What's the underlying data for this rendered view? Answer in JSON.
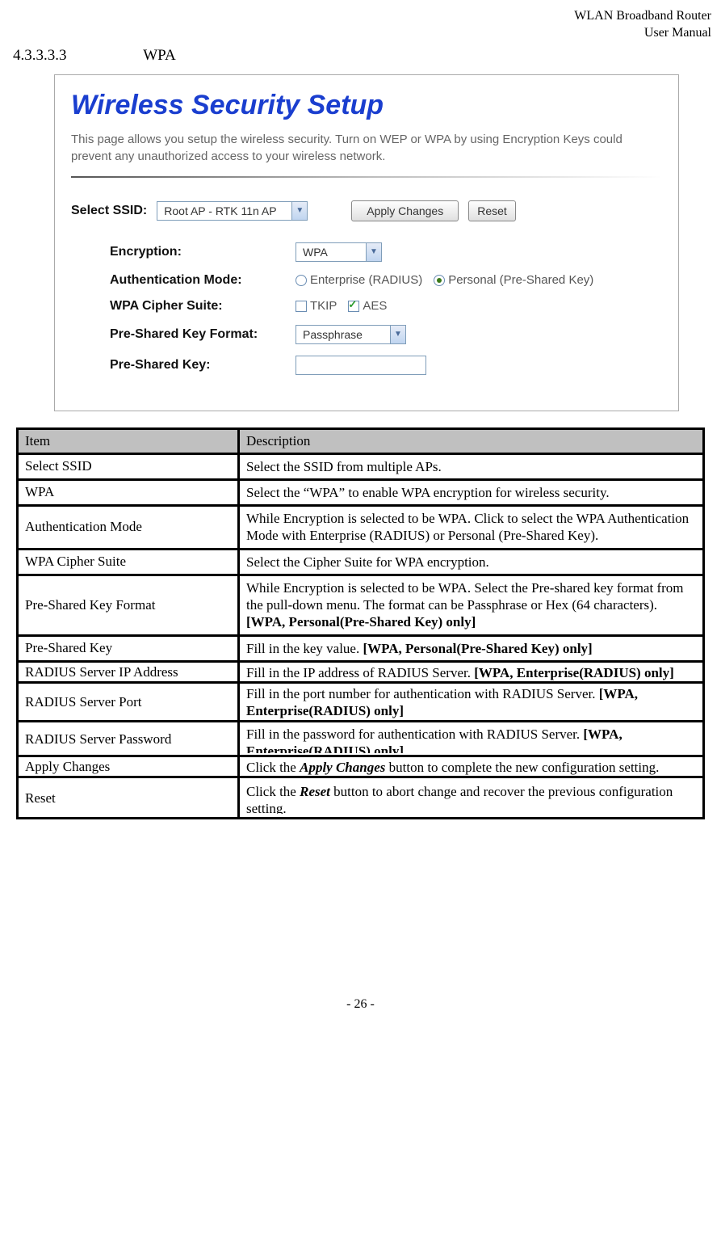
{
  "header": {
    "line1": "WLAN  Broadband  Router",
    "line2": "User  Manual"
  },
  "section": {
    "number": "4.3.3.3.3",
    "title": "WPA"
  },
  "screenshot": {
    "title": "Wireless Security Setup",
    "desc": "This page allows you setup the wireless security. Turn on WEP or WPA by using Encryption Keys could prevent any unauthorized access to your wireless network.",
    "selectSsidLabel": "Select SSID:",
    "selectSsidValue": "Root AP - RTK 11n AP",
    "applyChangesBtn": "Apply Changes",
    "resetBtn": "Reset",
    "encryptionLabel": "Encryption:",
    "encryptionValue": "WPA",
    "authModeLabel": "Authentication Mode:",
    "authOpt1": "Enterprise (RADIUS)",
    "authOpt2": "Personal (Pre-Shared Key)",
    "cipherLabel": "WPA Cipher Suite:",
    "cipherOpt1": "TKIP",
    "cipherOpt2": "AES",
    "pskFormatLabel": "Pre-Shared Key Format:",
    "pskFormatValue": "Passphrase",
    "pskLabel": "Pre-Shared Key:"
  },
  "table": {
    "hItem": "Item",
    "hDesc": "Description",
    "rows": [
      {
        "item": "Select SSID",
        "desc": "Select the SSID from multiple APs."
      },
      {
        "item": "WPA",
        "desc": "Select the “WPA” to enable WPA encryption for wireless security."
      },
      {
        "item": "Authentication Mode",
        "desc": "While Encryption is selected to be WPA. Click to select the WPA Authentication Mode with Enterprise (RADIUS) or Personal (Pre-Shared Key)."
      },
      {
        "item": "WPA Cipher Suite",
        "desc": "Select the Cipher Suite for WPA encryption."
      },
      {
        "item": "Pre-Shared Key Format",
        "desc_plain": "While Encryption is selected to be WPA. Select the Pre-shared key format from the pull-down menu. The format can be Passphrase or Hex (64 characters).",
        "desc_bold": "[WPA, Personal(Pre-Shared Key) only]"
      },
      {
        "item": "Pre-Shared Key",
        "desc_plain": "Fill in the key value. ",
        "desc_bold": "[WPA, Personal(Pre-Shared Key) only]"
      },
      {
        "item": "RADIUS Server IP Address",
        "desc_plain": "Fill in the IP address of RADIUS Server. ",
        "desc_bold": "[WPA, Enterprise(RADIUS) only]"
      },
      {
        "item": "RADIUS Server Port",
        "desc_plain": "Fill in the port number for authentication with RADIUS Server. ",
        "desc_bold": "[WPA, Enterprise(RADIUS) only]"
      },
      {
        "item": "RADIUS Server Password",
        "desc_plain": "Fill in the password for authentication with RADIUS Server. ",
        "desc_bold": "[WPA, Enterprise(RADIUS) only]"
      },
      {
        "item": "Apply Changes",
        "desc_plain_a": "Click the ",
        "desc_italic": "Apply Changes",
        "desc_plain_b": " button to complete the new configuration setting."
      },
      {
        "item": "Reset",
        "desc_plain_a": "Click the ",
        "desc_italic": "Reset",
        "desc_plain_b": " button to abort change and recover the previous configuration setting."
      }
    ]
  },
  "footer": "- 26 -"
}
